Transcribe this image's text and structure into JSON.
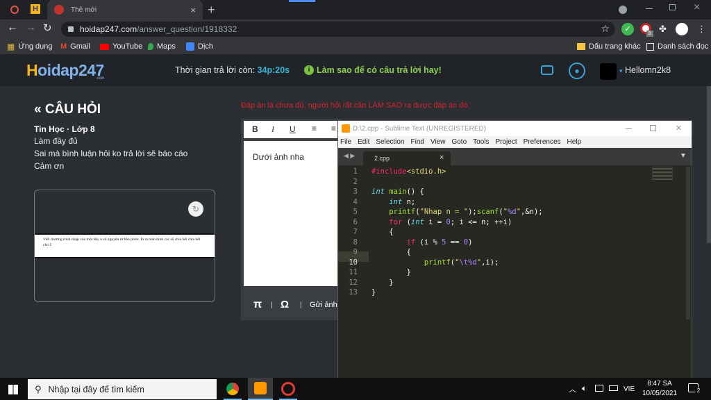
{
  "browser": {
    "tab_title": "Thẻ mới",
    "url_domain": "hoidap247.com",
    "url_path": "/answer_question/1918332",
    "bookmarks": [
      "Ứng dụng",
      "Gmail",
      "YouTube",
      "Maps",
      "Dịch"
    ],
    "bookmarks_right": [
      "Dấu trang khác",
      "Danh sách đọc"
    ],
    "extension_badge": "8"
  },
  "site": {
    "logo_h": "H",
    "logo_rest": "oidap247",
    "logo_sub": ".com",
    "timer_label": "Thời gian trả lời còn:",
    "timer_value": "34p:20s",
    "tip": "Làm sao để có câu trả lời hay!",
    "username": "Hellomn2k8",
    "section_title": "CÂU HỎI",
    "subject": "Tin Học · Lớp 8",
    "question_lines": [
      "Làm đầy đủ",
      "Sai mà bình luận hỏi ko trả lời sẽ báo cáo",
      "Cảm ơn"
    ],
    "image_text": "Viết chương trình nhập vào một dãy n số nguyên từ bàn phím. In ra màn hình các số chia hết chia hết cho 5",
    "warning": "Đáp án là chưa đủ, người hỏi rất cần LÀM SAO ra được đáp án đó.",
    "editor_text": "Dưới ảnh nha",
    "pi": "π",
    "omega": "Ω",
    "send_image": "Gửi ảnh"
  },
  "sublime": {
    "title": "D:\\2.cpp - Sublime Text (UNREGISTERED)",
    "menu": [
      "File",
      "Edit",
      "Selection",
      "Find",
      "View",
      "Goto",
      "Tools",
      "Project",
      "Preferences",
      "Help"
    ],
    "tab": "2.cpp",
    "line_numbers": [
      "1",
      "2",
      "3",
      "4",
      "5",
      "6",
      "7",
      "8",
      "9",
      "10",
      "11",
      "12",
      "13"
    ],
    "code": [
      "#include<stdio.h>",
      "",
      "int main() {",
      "    int n;",
      "    printf(\"Nhap n = \");scanf(\"%d\",&n);",
      "    for (int i = 0; i <= n; ++i)",
      "    {",
      "        if (i % 5 == 0)",
      "        {",
      "            printf(\"\\t%d\",i);",
      "        }",
      "    }",
      "}"
    ]
  },
  "taskbar": {
    "search_placeholder": "Nhập tại đây để tìm kiếm",
    "lang": "VIE",
    "time": "8:47 SA",
    "date": "10/05/2021",
    "notif_count": "2"
  }
}
